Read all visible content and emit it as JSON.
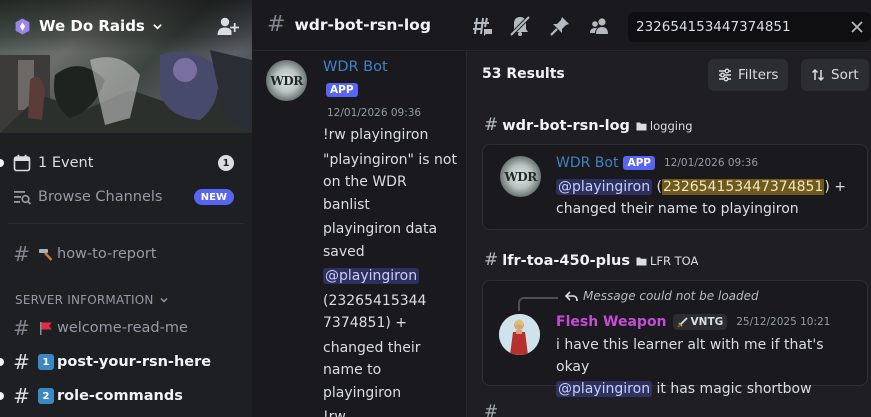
{
  "server": {
    "name": "We Do Raids"
  },
  "sidebar": {
    "event": {
      "label": "1 Event",
      "count": "1"
    },
    "browse": {
      "label": "Browse Channels",
      "badge": "NEW"
    },
    "channels_top": [
      {
        "label": "how-to-report"
      }
    ],
    "category": "SERVER INFORMATION",
    "channels": [
      {
        "label": "welcome-read-me"
      },
      {
        "label": "post-your-rsn-here",
        "emoji": "1"
      },
      {
        "label": "role-commands",
        "emoji": "2"
      }
    ]
  },
  "topbar": {
    "channel": "wdr-bot-rsn-log",
    "search_value": "232654153447374851"
  },
  "chat": {
    "author": "WDR Bot",
    "tag": "APP",
    "timestamp": "12/01/2026 09:36",
    "lines": {
      "l1": "!rw playingiron",
      "l2": "\"playingiron\" is not on the WDR banlist",
      "l3": "playingiron data saved",
      "mention": "@playingiron",
      "l4a": "(23265415344",
      "l4b": "7374851) +",
      "l5": "changed their name to playingiron",
      "l6": "!rw"
    }
  },
  "results": {
    "count_label": "53 Results",
    "filters_label": "Filters",
    "sort_label": "Sort",
    "groups": [
      {
        "channel": "wdr-bot-rsn-log",
        "category": "logging",
        "message": {
          "author": "WDR Bot",
          "tag": "APP",
          "timestamp": "12/01/2026 09:36",
          "mention": "@playingiron",
          "id_open": "(",
          "highlight": "232654153447374851",
          "id_close": ") +",
          "rest": "changed their name to playingiron"
        }
      },
      {
        "channel": "lfr-toa-450-plus",
        "category": "LFR TOA",
        "message": {
          "reply_note": "Message could not be loaded",
          "author": "Flesh Weapon",
          "clan_tag": "VNTG",
          "timestamp": "25/12/2025 10:21",
          "text": "i have this learner alt with me if that's okay",
          "mention": "@playingiron",
          "text2": " it has magic shortbow"
        }
      }
    ]
  },
  "colors": {
    "accent": "#5865f2",
    "bot_name": "#3f82c6",
    "flesh_name": "#c64bd6",
    "highlight": "#6f5a1e"
  }
}
